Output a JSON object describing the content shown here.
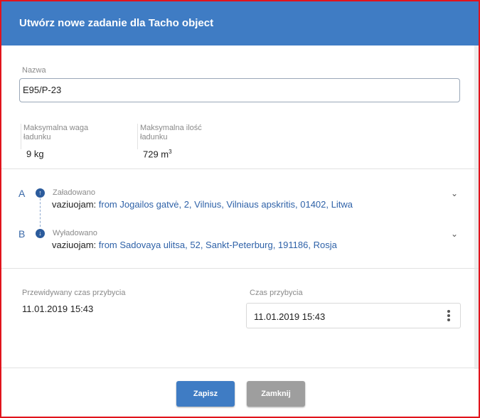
{
  "dialog": {
    "title": "Utwórz nowe zadanie dla Tacho object"
  },
  "form": {
    "name_label": "Nazwa",
    "name_value": "E95/P-23",
    "max_weight_label": "Maksymalna waga ładunku",
    "max_weight_value": "9 kg",
    "max_volume_label": "Maksymalna ilość ładunku",
    "max_volume_value": "729 m",
    "max_volume_unit_sup": "3"
  },
  "route": {
    "stops": [
      {
        "letter": "A",
        "icon": "arrow-up",
        "status": "Załadowano",
        "prefix": "vaziuojam: ",
        "address": "from Jogailos gatvė, 2, Vilnius, Vilniaus apskritis, 01402, Litwa"
      },
      {
        "letter": "B",
        "icon": "arrow-down",
        "status": "Wyładowano",
        "prefix": "vaziuojam: ",
        "address": "from Sadovaya ulitsa, 52, Sankt-Peterburg, 191186, Rosja"
      }
    ]
  },
  "arrival": {
    "expected_label": "Przewidywany czas przybycia",
    "expected_value": "11.01.2019 15:43",
    "actual_label": "Czas przybycia",
    "actual_value": "11.01.2019 15:43"
  },
  "footer": {
    "save_label": "Zapisz",
    "close_label": "Zamknij"
  },
  "colors": {
    "header": "#3f7cc4",
    "border": "#e1141c",
    "link": "#2f62a8",
    "close_button": "#9e9e9e"
  }
}
